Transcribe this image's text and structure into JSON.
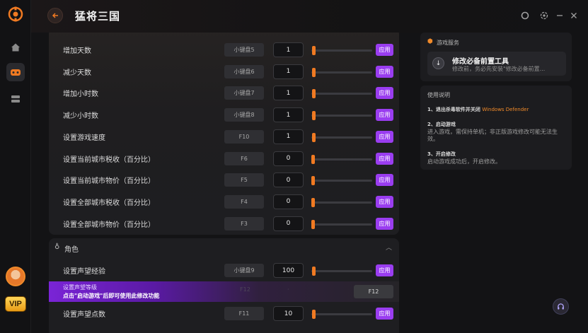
{
  "header": {
    "title": "猛将三国"
  },
  "rail": {
    "vip_label": "VIP"
  },
  "sections": {
    "top_rows": [
      {
        "label": "增加天数",
        "key": "小键盘5",
        "value": "1",
        "apply": "应用",
        "slider": 0.01
      },
      {
        "label": "减少天数",
        "key": "小键盘6",
        "value": "1",
        "apply": "应用",
        "slider": 0.01
      },
      {
        "label": "增加小时数",
        "key": "小键盘7",
        "value": "1",
        "apply": "应用",
        "slider": 0.01
      },
      {
        "label": "减少小时数",
        "key": "小键盘8",
        "value": "1",
        "apply": "应用",
        "slider": 0.01
      },
      {
        "label": "设置游戏速度",
        "key": "F10",
        "value": "1",
        "apply": "应用",
        "slider": 0.01
      },
      {
        "label": "设置当前城市税收（百分比）",
        "key": "F6",
        "value": "0",
        "apply": "应用",
        "slider": 0
      },
      {
        "label": "设置当前城市物价（百分比）",
        "key": "F5",
        "value": "0",
        "apply": "应用",
        "slider": 0
      },
      {
        "label": "设置全部城市税收（百分比）",
        "key": "F4",
        "value": "0",
        "apply": "应用",
        "slider": 0
      },
      {
        "label": "设置全部城市物价（百分比）",
        "key": "F3",
        "value": "0",
        "apply": "应用",
        "slider": 0
      }
    ],
    "roles": {
      "title": "角色",
      "rows": [
        {
          "label": "设置声望经验",
          "key": "小键盘9",
          "value": "100",
          "apply": "应用",
          "slider": 0.01
        },
        {
          "label": "设置声望点数",
          "key": "F11",
          "value": "10",
          "apply": "应用",
          "slider": 0.01
        }
      ],
      "promo": {
        "label": "设置声望等级",
        "notice": "点击\"启动游戏\"后即可使用此修改功能",
        "key": "F12"
      }
    }
  },
  "right": {
    "service": {
      "title": "游戏服务",
      "item_name": "修改必备前置工具",
      "item_desc": "修改前，务必先安装\"修改必备前置..."
    },
    "instructions": {
      "title": "使用说明",
      "step1": "1、退出杀毒软件并关闭",
      "step1_highlight": "Windows Defender",
      "step2": "2、启动游戏",
      "step2_desc": "进入游戏，需保持单机；非正版游戏修改可能无法生效。",
      "step3": "3、开启修改",
      "step3_desc": "启动游戏成功后，开启修改。"
    }
  },
  "colors": {
    "accent": "#f07a22",
    "apply": "#9a3df0",
    "promo": "#7a24d6"
  },
  "icons": [
    "app-logo-icon",
    "home-icon",
    "games-icon",
    "storage-icon",
    "back-arrow-icon",
    "skin-icon",
    "settings-icon",
    "minimize-icon",
    "close-icon",
    "cube-icon",
    "download-icon",
    "headset-icon",
    "role-icon",
    "chevron-up-icon"
  ]
}
